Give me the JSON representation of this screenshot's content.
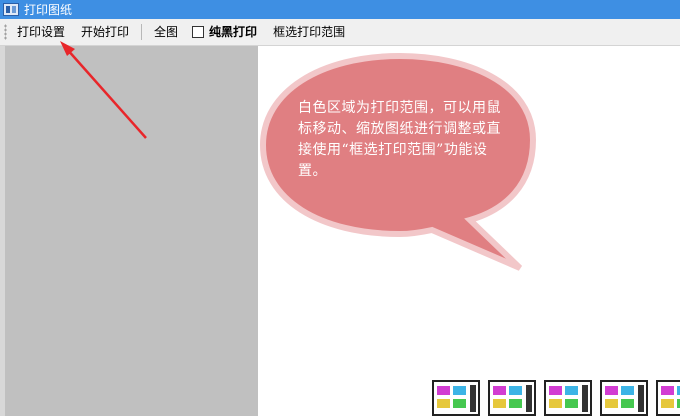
{
  "window": {
    "title": "打印图纸",
    "icon": "app-icon"
  },
  "toolbar": {
    "print_settings": "打印设置",
    "start_print": "开始打印",
    "full_view": "全图",
    "pure_black_print": "纯黑打印",
    "pure_black_checked": false,
    "select_print_range": "框选打印范围"
  },
  "callout": {
    "text": "白色区域为打印范围，可以用鼠标移动、缩放图纸进行调整或直接使用“框选打印范围”功能设置。",
    "fill_color": "#e07f82",
    "border_color": "#f2c7c9"
  },
  "annotation": {
    "arrow_color": "#e8262a"
  },
  "colors": {
    "titlebar": "#3e8fe3",
    "toolbar": "#f0f0f0",
    "left_panel": "#c0c0c0",
    "print_area": "#ffffff"
  },
  "thumbnails": [
    {
      "name": "sheet-thumbnail"
    },
    {
      "name": "sheet-thumbnail"
    },
    {
      "name": "sheet-thumbnail"
    },
    {
      "name": "sheet-thumbnail"
    },
    {
      "name": "sheet-thumbnail"
    }
  ]
}
